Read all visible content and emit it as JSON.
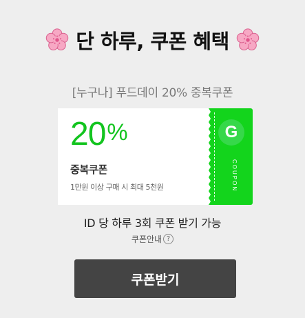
{
  "header": {
    "title": "단 하루, 쿠폰 혜택",
    "left_icon": "cherry-blossom-icon",
    "right_icon": "cherry-blossom-icon",
    "icon_color": "#f6a3c0"
  },
  "subtitle": "[누구나] 푸드데이 20% 중복쿠폰",
  "coupon": {
    "discount_number": "20",
    "discount_unit": "%",
    "type": "중복쿠폰",
    "condition": "1만원 이상 구매 시 최대 5천원",
    "stub_icon": "g-logo-icon",
    "stub_letter": "G",
    "stub_label": "COUPON",
    "accent_color": "#13d41c"
  },
  "limit_text": "ID 당 하루 3회 쿠폰 받기 가능",
  "guide": {
    "label": "쿠폰안내",
    "help_glyph": "?"
  },
  "cta": {
    "label": "쿠폰받기",
    "color": "#444444"
  }
}
